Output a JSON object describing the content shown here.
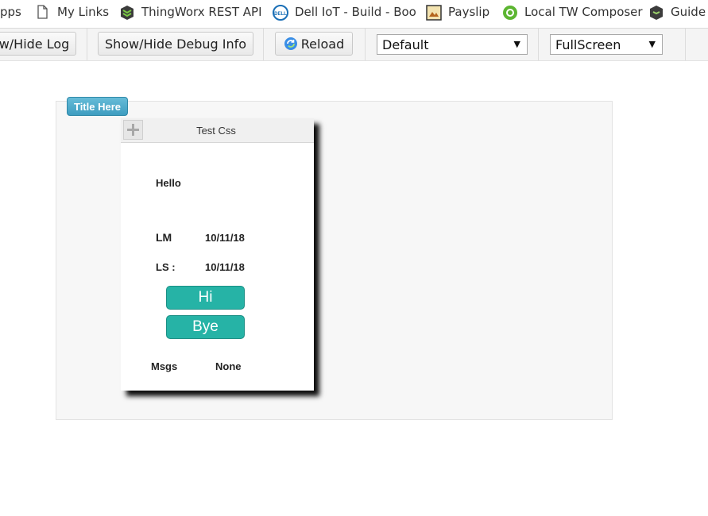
{
  "bookmarks": [
    {
      "label": "pps",
      "icon": "apps-grid-icon"
    },
    {
      "label": "My Links",
      "icon": "document-icon"
    },
    {
      "label": "ThingWorx REST API",
      "icon": "thingworx-icon"
    },
    {
      "label": "Dell IoT - Build - Boo",
      "icon": "dell-icon"
    },
    {
      "label": "Payslip",
      "icon": "payslip-icon"
    },
    {
      "label": "Local TW Composer",
      "icon": "composer-icon"
    },
    {
      "label": "Guide W",
      "icon": "guide-icon"
    }
  ],
  "toolbar": {
    "log_button": "w/Hide Log",
    "debug_button": "Show/Hide Debug Info",
    "reload_button": "Reload",
    "theme_select": "Default",
    "view_select": "FullScreen"
  },
  "mashup": {
    "title_tab": "Title Here",
    "card": {
      "title": "Test Css",
      "hello": "Hello",
      "lm_label": "LM",
      "lm_value": "10/11/18",
      "ls_label": "LS :",
      "ls_value": "10/11/18",
      "hi_button": "Hi",
      "bye_button": "Bye",
      "msgs_label": "Msgs",
      "msgs_value": "None"
    }
  },
  "colors": {
    "accent_teal": "#26b3a6",
    "title_tab_blue": "#4aa7c9"
  }
}
